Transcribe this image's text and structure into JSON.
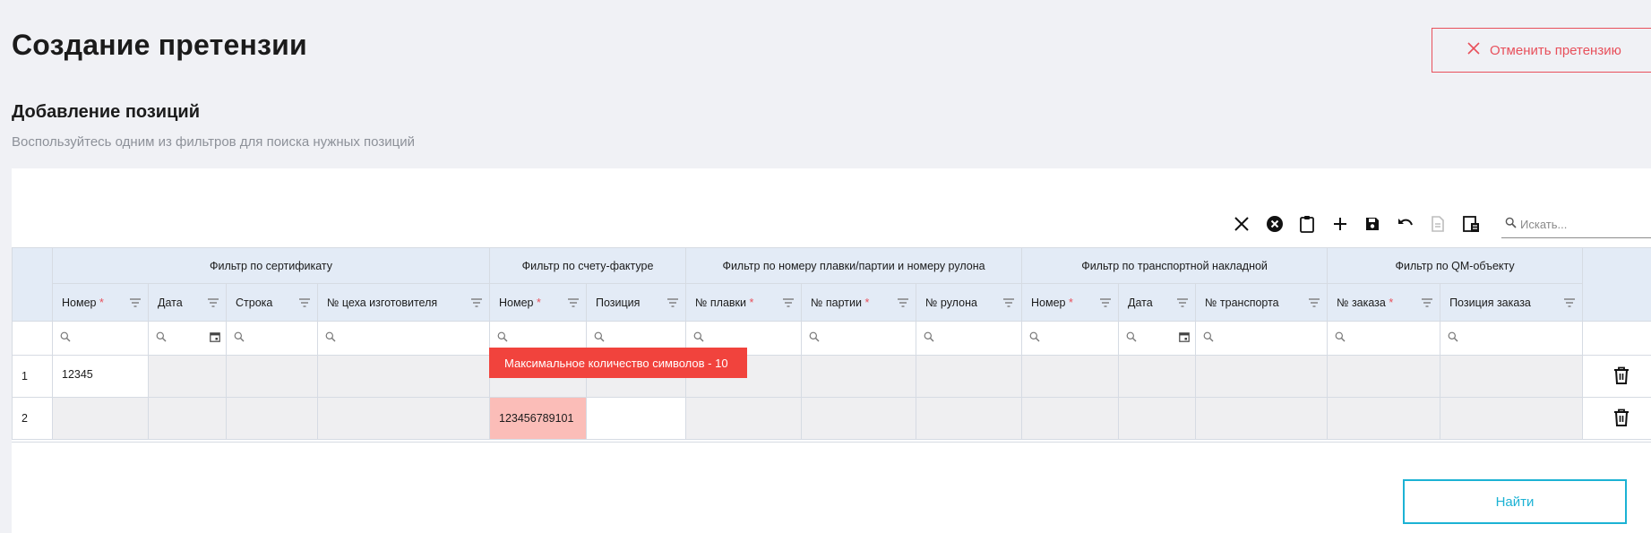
{
  "page": {
    "title": "Создание претензии",
    "cancel_label": "Отменить претензию",
    "section_title": "Добавление позиций",
    "section_subtitle": "Воспользуйтесь одним из фильтров для поиска нужных позиций",
    "find_label": "Найти"
  },
  "toolbar": {
    "icons": [
      "close-icon",
      "cancel-circle-icon",
      "clipboard-icon",
      "add-icon",
      "save-icon",
      "undo-icon",
      "export-disabled-icon",
      "paste-table-icon"
    ],
    "search_placeholder": "Искать..."
  },
  "table": {
    "groups": [
      "Фильтр по сертификату",
      "Фильтр по счету-фактуре",
      "Фильтр по номеру плавки/партии и номеру рулона",
      "Фильтр по транспортной накладной",
      "Фильтр по QM-объекту"
    ],
    "columns": [
      {
        "label": "Номер",
        "required": "*"
      },
      {
        "label": "Дата",
        "required": ""
      },
      {
        "label": "Строка",
        "required": ""
      },
      {
        "label": "№ цеха изготовителя",
        "required": ""
      },
      {
        "label": "Номер",
        "required": "*"
      },
      {
        "label": "Позиция",
        "required": ""
      },
      {
        "label": "№ плавки",
        "required": "*"
      },
      {
        "label": "№ партии",
        "required": "*"
      },
      {
        "label": "№ рулона",
        "required": ""
      },
      {
        "label": "Номер",
        "required": "*"
      },
      {
        "label": "Дата",
        "required": ""
      },
      {
        "label": "№ транспорта",
        "required": ""
      },
      {
        "label": "№ заказа",
        "required": "*"
      },
      {
        "label": "Позиция заказа",
        "required": ""
      }
    ],
    "rows": [
      {
        "index": "1",
        "cert_number": "12345",
        "invoice_number": ""
      },
      {
        "index": "2",
        "cert_number": "",
        "invoice_number": "123456789101"
      }
    ],
    "error_tooltip": "Максимальное количество символов - 10"
  },
  "colors": {
    "accent_red": "#e8505b",
    "accent_cyan": "#1cb2d4",
    "header_bg": "#e3ebf6",
    "error_bg": "#fbbdb8",
    "tooltip_bg": "#f1433d"
  }
}
